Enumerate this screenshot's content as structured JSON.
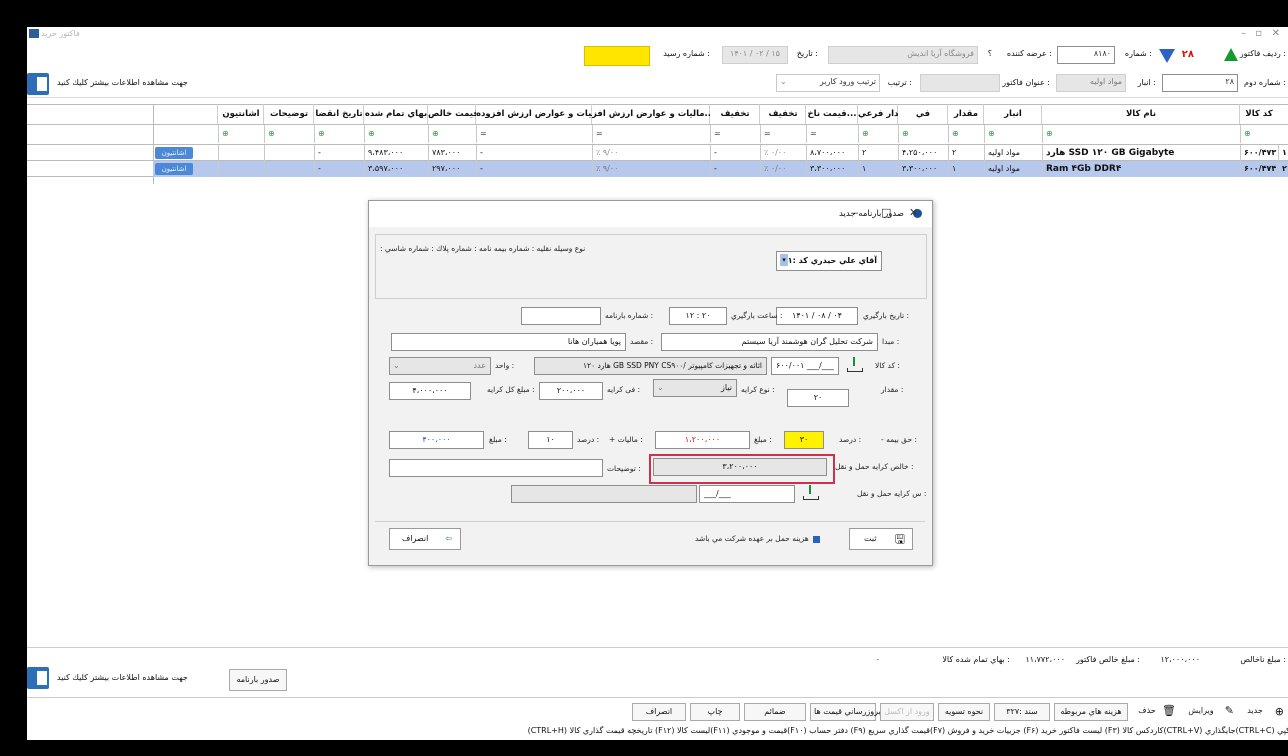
{
  "window": {
    "title": "فاكتور خريد"
  },
  "header_row1": {
    "row_label": "رديف فاكتور :",
    "number_label": "شماره :",
    "number_value": "۲۸",
    "supplier_label": "عرضه كننده :",
    "supplier_code": "۸۱۸۰",
    "supplier_marker": "؟",
    "supplier_name": "فروشگاه آريا انديش",
    "date_label": "تاريخ :",
    "date_value": "۱۴۰۱ / ۰۲ / ۱۵",
    "receipt_label": "شماره رسيد :"
  },
  "header_row2": {
    "second_number_label": "شماره دوم :",
    "second_number_value": "۲۸",
    "warehouse_label": "انبار :",
    "warehouse_value": "مواد اوليه",
    "title_label": "عنوان فاكتور :",
    "order_label": "ترتيب :",
    "order_value": "ترتيب ورود كاربر",
    "more_info": "جهت مشاهده اطلاعات بيشتر كليك كنيد"
  },
  "grid": {
    "columns": [
      "كد كالا",
      "نام كالا",
      "انبار",
      "مقدار",
      "في",
      "مقدار فرعي",
      "قيمت ناخ...",
      "تخفيف",
      "تخفيف",
      "ماليات و عوارض ارزش افز...",
      "ماليات و عوارض ارزش افزوده",
      "قيمت خالص",
      "بهاي تمام شده",
      "تاريخ انقضا",
      "توضيحات",
      "اشانتيون"
    ],
    "rows": [
      {
        "idx": "۱",
        "code": "۶۰۰/۴۷۳",
        "name": "هارد SSD ۱۲۰ GB Gigabyte",
        "warehouse": "مواد اوليه",
        "qty": "۲",
        "price": "۴،۲۵۰،۰۰۰",
        "sub_qty": "۲",
        "gross": "۸،۷۰۰،۰۰۰",
        "disc_pct": "٪ ۰/۰۰",
        "disc": "-",
        "vat_pct": "٪ ۹/۰۰",
        "vat": "-",
        "net": "۹،۴۸۳،۰۰۰",
        "vat_amt": "۷۸۳،۰۰۰",
        "cost": "-",
        "expiry": "",
        "desc": "",
        "gift": "اشانتيون"
      },
      {
        "idx": "۲",
        "code": "۶۰۰/۴۷۴",
        "name": "Ram ۴Gb DDR۴",
        "warehouse": "مواد اوليه",
        "qty": "۱",
        "price": "۳،۳۰۰،۰۰۰",
        "sub_qty": "۱",
        "gross": "۳،۳۰۰،۰۰۰",
        "disc_pct": "٪ ۰/۰۰",
        "disc": "-",
        "vat_pct": "٪ ۹/۰۰",
        "vat": "-",
        "net": "۳،۵۹۷،۰۰۰",
        "vat_amt": "۲۹۷،۰۰۰",
        "cost": "-",
        "expiry": "",
        "desc": "",
        "gift": "اشانتيون"
      }
    ]
  },
  "dialog": {
    "title": "صدور بارنامه جديد",
    "vehicle_labels": "نوع وسيله نقليه : شماره بيمه نامه : شماره پلاك : شماره شاسي :",
    "driver": "آقاي علي حيدري كد :۱",
    "load_date_label": "تاريخ بارگيري :",
    "load_date": "۱۴۰۱ / ۰۸ / ۰۴",
    "load_time_label": "ساعت بارگيري :",
    "load_time": "۱۲ : ۲۰",
    "waybill_no_label": "شماره بارنامه :",
    "origin_label": "مبدا :",
    "origin": "شركت تحليل گران هوشمند آريا سيستم",
    "destination_label": "مقصد :",
    "destination": "پويا همياران هانا",
    "item_code_label": "كد كالا :",
    "item_code": "۶۰۰/۰۰۱",
    "item_code_extra": "___/___",
    "item_name": "هارد ۱۲۰ GB SSD PNY CS۹۰۰/ اثاثه و تجهيزات كامپيوتر",
    "unit_label": "واحد :",
    "unit": "عدد",
    "qty_label": "مقدار :",
    "qty": "۲۰",
    "fare_type_label": "نوع كرايه :",
    "fare_type": "نياز",
    "fare_rate_label": "فی كرايه :",
    "fare_rate": "۲۰۰،۰۰۰",
    "fare_total_label": "مبلغ كل كرايه :",
    "fare_total": "۴،۰۰۰،۰۰۰",
    "insurance_label": "- حق بيمه :",
    "percent_label": "درصد :",
    "insurance_pct": "۳۰",
    "amount_label": "مبلغ :",
    "insurance_amount": "۱،۲۰۰،۰۰۰",
    "tax_label": "+ ماليات :",
    "tax_pct": "۱۰",
    "tax_amount": "۴۰۰،۰۰۰",
    "net_label": "خالص كرايه حمل و نقل :",
    "net_value": "۳،۲۰۰،۰۰۰",
    "desc_label": "توضيحات :",
    "doc_label": "س كرايه حمل و نقل :",
    "doc_value": "___/___",
    "company_pays": "هزينه حمل بر عهده شركت مي باشد",
    "save": "ثبت",
    "cancel": "انصراف"
  },
  "footer": {
    "net_label": "مبلغ ناخالص :",
    "net_value": "۱۲،۰۰۰،۰۰۰",
    "invoice_net_label": "مبلغ خالص فاكتور :",
    "invoice_net_value": "۱۱،۷۷۲،۰۰۰",
    "cost_label": "بهاي تمام شده كالا :",
    "dot": "٠",
    "issue_waybill": "صدور بارنامه",
    "more_info": "جهت مشاهده اطلاعات بيشتر كليك كنيد",
    "buttons": [
      "جديد",
      "ويرايش",
      "حذف",
      "هزينه هاي مربوطه",
      "سند :۳۲۷",
      "نحوه تسويه",
      "ورود از اكسل",
      "بروزرساني قيمت ها",
      "ضمائم",
      "چاپ",
      "انصراف"
    ],
    "shortcuts": "كپي (CTRL+C)جايگذاري (CTRL+V)كاردكس كالا (F۳) ليست فاكتور خريد (F۶) جزييات خريد و فروش (F۷)قيمت گذاري سريع (F۹) دفتر حساب (F۱۰)قيمت و موجودي (F۱۱)ليست كالا (F۱۲) تاريخچه قيمت گذاري كالا (CTRL+H)"
  }
}
